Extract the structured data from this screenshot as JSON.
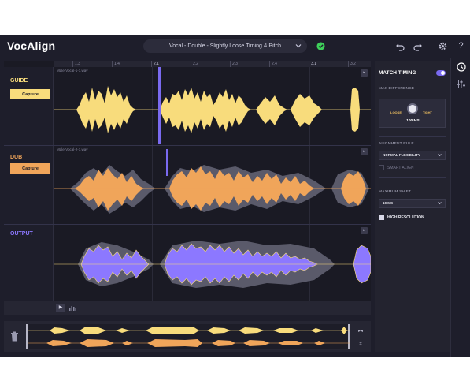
{
  "header": {
    "app_title": "VocAlign",
    "preset": "Vocal - Double - Slightly Loose Timing & Pitch",
    "buttons": [
      "undo-icon",
      "redo-icon",
      "gear-icon",
      "help-icon"
    ],
    "help_glyph": "?"
  },
  "ruler": {
    "ticks": [
      "1.3",
      "1.4",
      "2.1",
      "2.2",
      "2.3",
      "2.4",
      "3.1",
      "3.2"
    ]
  },
  "lanes": {
    "guide": {
      "title": "GUIDE",
      "button": "Capture",
      "file": "Male-Vocal-1-1.wav",
      "color": "#f8dc7c"
    },
    "dub": {
      "title": "DUB",
      "button": "Capture",
      "file": "Male-Vocal-2-1.wav",
      "color": "#f0a55a"
    },
    "output": {
      "title": "OUTPUT",
      "color": "#8c78ff"
    }
  },
  "panel": {
    "match_timing": "MATCH TIMING",
    "max_difference_label": "MAX DIFFERENCE",
    "knob_left": "LOOSE",
    "knob_right": "TIGHT",
    "knob_value": "100 MS",
    "alignment_rule_label": "ALIGNMENT RULE",
    "alignment_rule_value": "NORMAL FLEXIBILITY",
    "smart_align": "SMART ALIGN",
    "maximum_shift_label": "MAXIMUM SHIFT",
    "maximum_shift_value": "10 MS",
    "high_resolution": "HIGH RESOLUTION"
  },
  "colors": {
    "accent": "#7a6af0",
    "guide": "#f8dc7c",
    "dub": "#f0a55a",
    "output": "#8c78ff",
    "ok": "#3ecf5a"
  }
}
